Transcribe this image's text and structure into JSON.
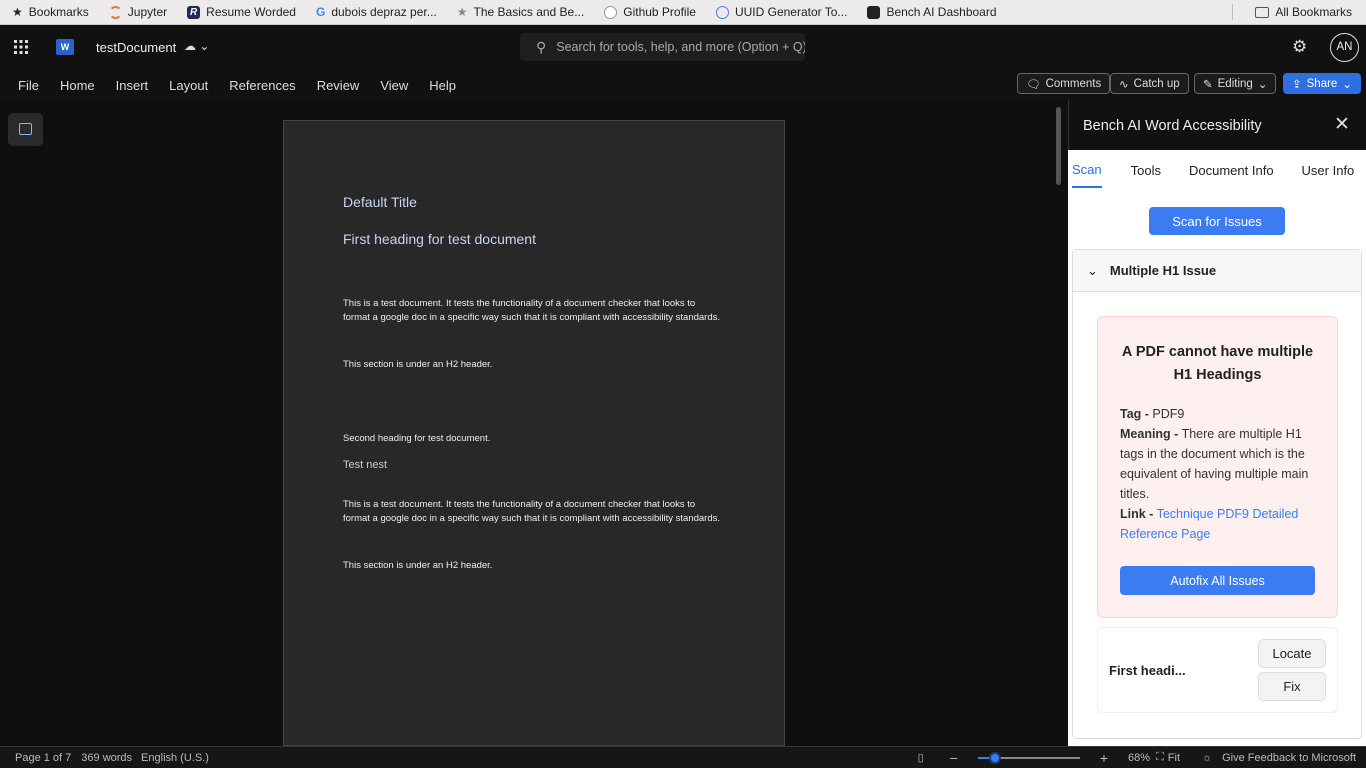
{
  "bookmarks": {
    "items": [
      {
        "label": "Bookmarks",
        "icon": "star-icon"
      },
      {
        "label": "Jupyter",
        "icon": "jupyter-icon"
      },
      {
        "label": "Resume Worded",
        "icon": "resume-worded-icon"
      },
      {
        "label": "dubois depraz per...",
        "icon": "google-icon"
      },
      {
        "label": "The Basics and Be...",
        "icon": "star-icon"
      },
      {
        "label": "Github Profile",
        "icon": "github-icon"
      },
      {
        "label": "UUID Generator To...",
        "icon": "globe-icon"
      },
      {
        "label": "Bench AI Dashboard",
        "icon": "bench-icon"
      }
    ],
    "all_label": "All Bookmarks"
  },
  "header": {
    "doc_title": "testDocument",
    "search_placeholder": "Search for tools, help, and more (Option + Q)",
    "avatar": "AN"
  },
  "menu": [
    "File",
    "Home",
    "Insert",
    "Layout",
    "References",
    "Review",
    "View",
    "Help"
  ],
  "toolbar": {
    "comments": "Comments",
    "catch_up": "Catch up",
    "editing": "Editing",
    "share": "Share"
  },
  "document": {
    "title": "Default Title",
    "heading1": "First heading for test document",
    "para1": "This is a test document. It tests the functionality of a document checker that looks to format a google doc in a specific way such that it is compliant with accessibility standards.",
    "para2": "This section is under an H2 header.",
    "heading2": "Second heading for test document.",
    "heading3": "Test nest",
    "para3": "This is a test document. It tests the functionality of a document checker that looks to format a google doc in a specific way such that it is compliant with accessibility standards.",
    "para4": "This section is under an H2 header."
  },
  "panel": {
    "title": "Bench AI Word Accessibility",
    "tabs": [
      "Scan",
      "Tools",
      "Document Info",
      "User Info"
    ],
    "active_tab": "Scan",
    "scan_button": "Scan for Issues",
    "issue_title": "Multiple H1 Issue",
    "card": {
      "heading": "A PDF cannot have multiple H1 Headings",
      "tag_label": "Tag -",
      "tag": "PDF9",
      "meaning_label": "Meaning -",
      "meaning": "There are multiple H1 tags in the document which is the equivalent of having multiple main titles.",
      "link_label": "Link -",
      "link": "Technique PDF9 Detailed Reference Page",
      "autofix": "Autofix All Issues"
    },
    "item": {
      "label": "First headi...",
      "locate": "Locate",
      "fix": "Fix"
    }
  },
  "status": {
    "page": "Page 1 of 7",
    "words": "369 words",
    "language": "English (U.S.)",
    "zoom": "68%",
    "zoom_percent": 68,
    "fit": "Fit",
    "feedback": "Give Feedback to Microsoft"
  },
  "colors": {
    "accent": "#3b7cf3",
    "card_bg": "#fdf0ee",
    "link": "#3b7cf3"
  }
}
